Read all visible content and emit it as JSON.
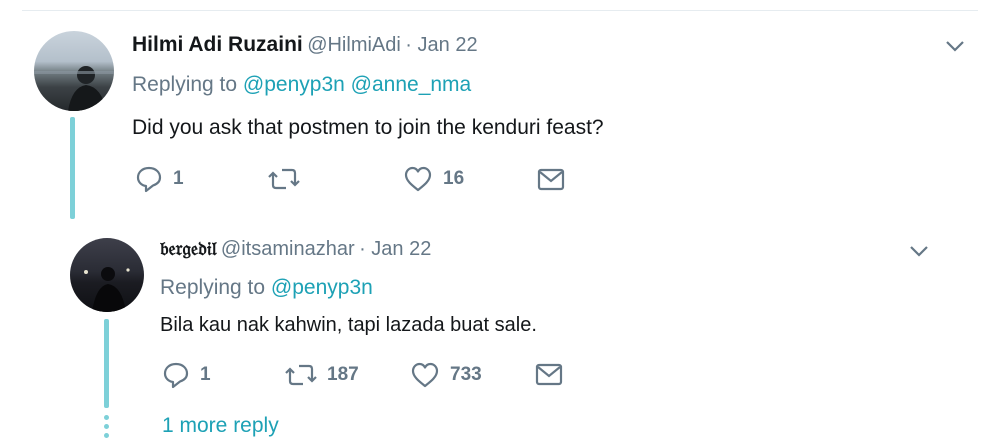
{
  "tweet1": {
    "name": "Hilmi Adi Ruzaini",
    "handle": "@HilmiAdi",
    "date": "· Jan 22",
    "replying_label": "Replying to",
    "mentions": [
      "@penyp3n",
      "@anne_nma"
    ],
    "text": "Did you ask that postmen to join the kenduri feast?",
    "replies": "1",
    "retweets": "",
    "likes": "16"
  },
  "tweet2": {
    "name": "𝔟𝔢𝔯𝔤𝔢𝔡𝔦𝔩",
    "handle": "@itsaminazhar",
    "date": "· Jan 22",
    "replying_label": "Replying to",
    "mentions": [
      "@penyp3n"
    ],
    "text": "Bila kau nak kahwin, tapi lazada buat sale.",
    "replies": "1",
    "retweets": "187",
    "likes": "733"
  },
  "more_replies": "1 more reply",
  "colors": {
    "accent": "#1da1b5",
    "thread": "#7dd0d8",
    "muted": "#657786"
  },
  "icons": [
    "reply-icon",
    "retweet-icon",
    "like-icon",
    "message-icon",
    "chevron-down-icon"
  ]
}
